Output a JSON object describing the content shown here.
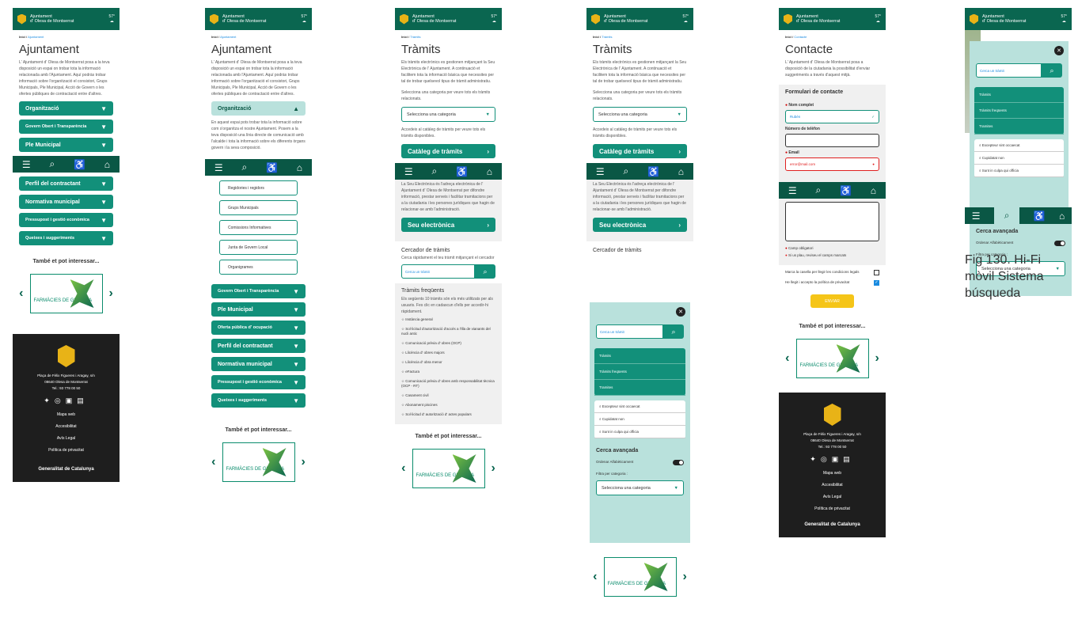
{
  "header": {
    "line1": "Ajuntament",
    "line2": "d' Olesa de Montserrat",
    "temp": "57°",
    "weather_icon": "cloud-rain-icon"
  },
  "nav": {
    "icons": [
      "menu-icon",
      "search-icon",
      "accessibility-icon",
      "home-icon"
    ]
  },
  "p1": {
    "crumb_home": "Inici /",
    "crumb_cur": "Ajuntament",
    "title": "Ajuntament",
    "intro": "L' Ajuntament d' Olesa de Montserrat posa a la teva disposició un espai on trobar tota la informació relacionada amb l'Ajuntament. Aquí podràs trobar informació sobre l'organització el consistori, Grups Municipals, Ple Municipal, Acció de Govern o les ofertes públiques de contractació entre d'altres.",
    "items": [
      "Organització",
      "Govern Obert i Transparència",
      "Ple Municipal",
      "Perfil del contractant",
      "Normativa municipal",
      "Pressupost i gestió econòmica",
      "Queixes i suggeriments"
    ]
  },
  "also": "També et pot interessar...",
  "farm": "FARMÀCIES DE GUÀRDIA",
  "footer": {
    "addr": "Plaça de Fèlix Figueres i Aragay, s/n",
    "city": "08640 Olesa de Montserrat",
    "tel": "Tel.: 93 778 00 50",
    "links": [
      "Mapa web",
      "Accesibilitat",
      "Avís Legal",
      "Política de privacitat"
    ],
    "gen": "Generalitat de Catalunya"
  },
  "p2": {
    "org_text": "En aquest espai pots trobar tota la informació sobre com s'organitza el nostre Ajuntament. Posem a la teva disposició una línia directe de comunicació amb l'alcalde i tota la informació sobre els diferents òrgans govern i la seva composició.",
    "subs": [
      "Regidories i regidors",
      "Grups Municipals",
      "Comissions Informatives",
      "Junta de Govern Local",
      "Organigrames"
    ],
    "items": [
      "Govern Obert i Transparència",
      "Ple Municipal",
      "Oferta pública d' ocupació",
      "Perfil del contractant",
      "Normativa municipal",
      "Pressupost i gestió econòmica",
      "Queixes i suggeriments"
    ]
  },
  "p3": {
    "crumb_cur": "Tràmits",
    "title": "Tràmits",
    "intro": "Els tràmits electrònics es gestionen mitjançant la Seu Electrònica de l' Ajuntament. A continuació et facilitem tota la informació bàsica que necessites per tal de trobar quelsevol tipus de tràmit administratiu.",
    "sel_text": "Selecciona una categoria per veure tots els tràmits relacionats.",
    "select": "Selecciona una categoria",
    "cat_text": "Accedeix al catàleg de tràmits per veure tots els tràmits disponibles.",
    "cat_btn": "Catàleg de tràmits",
    "seu_text": "La Seu Electrònica és l'adreça electrònica de l' Ajuntament d' Olesa de Montserrat per difondre informació, prestar serveis i facilitar tramitacions per a la ciutadania i les persones jurídiques que hagin de relacionar-se amb l'administració.",
    "seu_btn": "Seu electrònica",
    "cerc": "Cercador de tràmits",
    "cerc_text": "Cerca ràpidament el teu tràmit mitjançant el cercador",
    "placeholder": "Cerca un tràmit",
    "freq": "Tràmits freqüents",
    "freq_text": "Els següents 10 tràmits són els més utilitzats per als usuaris. Fes clic en cadascun d'ells per accedir-hi ràpidament.",
    "freq_items": [
      "Instància general",
      "Sol·licitud d'autorització d'accés a l'illa de vianants del nucli antic",
      "Comunicació prèvia d' obres (OCP)",
      "Llicència d' obres majors",
      "Llicència d' obra menor",
      "eFactura",
      "Comunicació prèvia d' obres amb responsabilitat tècnica (OCP - RT)",
      "Casament civil",
      "Abonament piscines",
      "Sol·licitud d' autorització d' actes populars"
    ]
  },
  "search": {
    "panel": [
      "Tràmits",
      "Tràmits freqüents",
      "Tramites"
    ],
    "results": [
      "Excepteur sint occaecat",
      "Cupidatat non",
      "Sunt in culpa qui officia"
    ],
    "adv": "Cerca avançada",
    "order": "Ordenar Alfabèticament",
    "filter": "Filtra per categoria :"
  },
  "p5": {
    "crumb_cur": "Contacte",
    "title": "Contacte",
    "intro": "L' Ajuntament d' Olesa de Montserrat posa a disposició de la ciutadania la possibilitat d'enviar suggeriments a través d'aquest mitjà.",
    "form": "Formulari de contacte",
    "name_lbl": "Nom complet",
    "name_val": "Rubén",
    "tel_lbl": "Número de telèfon",
    "email_lbl": "Email",
    "email_val": "error@mail.com",
    "req": "Camp obligatori",
    "err": "Si us plau, reviseu el camps marcats",
    "chk1": "Marca la casella per llegir les condicions legals",
    "chk2": "He llegit i accepto la política de privacitat",
    "send": "ENVIAR"
  },
  "caption": "Fig 130. Hi-Fi mòvil Sistema búsqueda"
}
